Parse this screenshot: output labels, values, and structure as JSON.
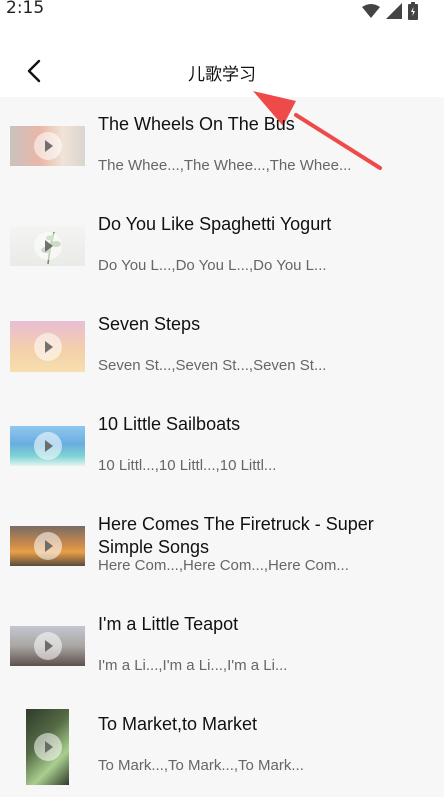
{
  "status_bar": {
    "time": "2:15",
    "icons": [
      "wifi-icon",
      "signal-icon",
      "battery-icon"
    ]
  },
  "header": {
    "back_icon": "chevron-left-icon",
    "title": "儿歌学习"
  },
  "songs": [
    {
      "title": "The Wheels On The Bus",
      "subtitle": "The Whee...,The Whee...,The Whee..."
    },
    {
      "title": "Do You Like Spaghetti Yogurt",
      "subtitle": "Do You L...,Do You L...,Do You L..."
    },
    {
      "title": "Seven Steps",
      "subtitle": "Seven St...,Seven St...,Seven St..."
    },
    {
      "title": "10 Little Sailboats",
      "subtitle": "10 Littl...,10 Littl...,10 Littl..."
    },
    {
      "title": "Here Comes The Firetruck - Super Simple Songs",
      "subtitle": "Here Com...,Here Com...,Here Com..."
    },
    {
      "title": "I'm a Little Teapot",
      "subtitle": "I'm a Li...,I'm a Li...,I'm a Li..."
    },
    {
      "title": "To  Market,to  Market",
      "subtitle": "To  Mark...,To  Mark...,To  Mark..."
    }
  ],
  "colors": {
    "annotation_arrow": "#ef4a4a",
    "background": "#f7f7f7",
    "header_bg": "#ffffff"
  }
}
